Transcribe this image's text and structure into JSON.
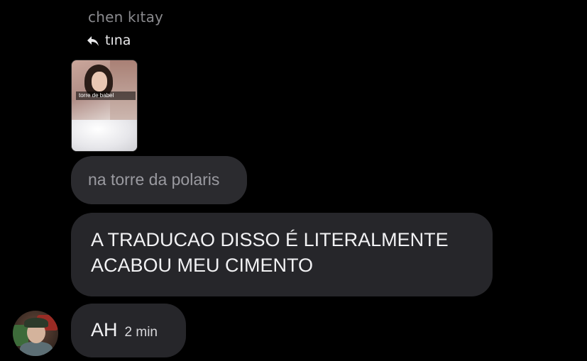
{
  "reply_context": {
    "header": "chen kıtay",
    "reply_to_name": "tına",
    "reply_icon": "reply-arrow-icon"
  },
  "media": {
    "caption": "torre de babel"
  },
  "messages": [
    {
      "id": "m1",
      "text": "na torre da polaris",
      "style": "faded"
    },
    {
      "id": "m2",
      "line1": "A TRADUCAO DISSO É LITERALMENTE",
      "line2": "ACABOU MEU CIMENTO"
    },
    {
      "id": "m3",
      "text": "AH",
      "time": "2 min"
    }
  ],
  "colors": {
    "background": "#000000",
    "bubble": "#26262a",
    "text": "#f2f2f4",
    "muted": "#9a9aa0"
  }
}
